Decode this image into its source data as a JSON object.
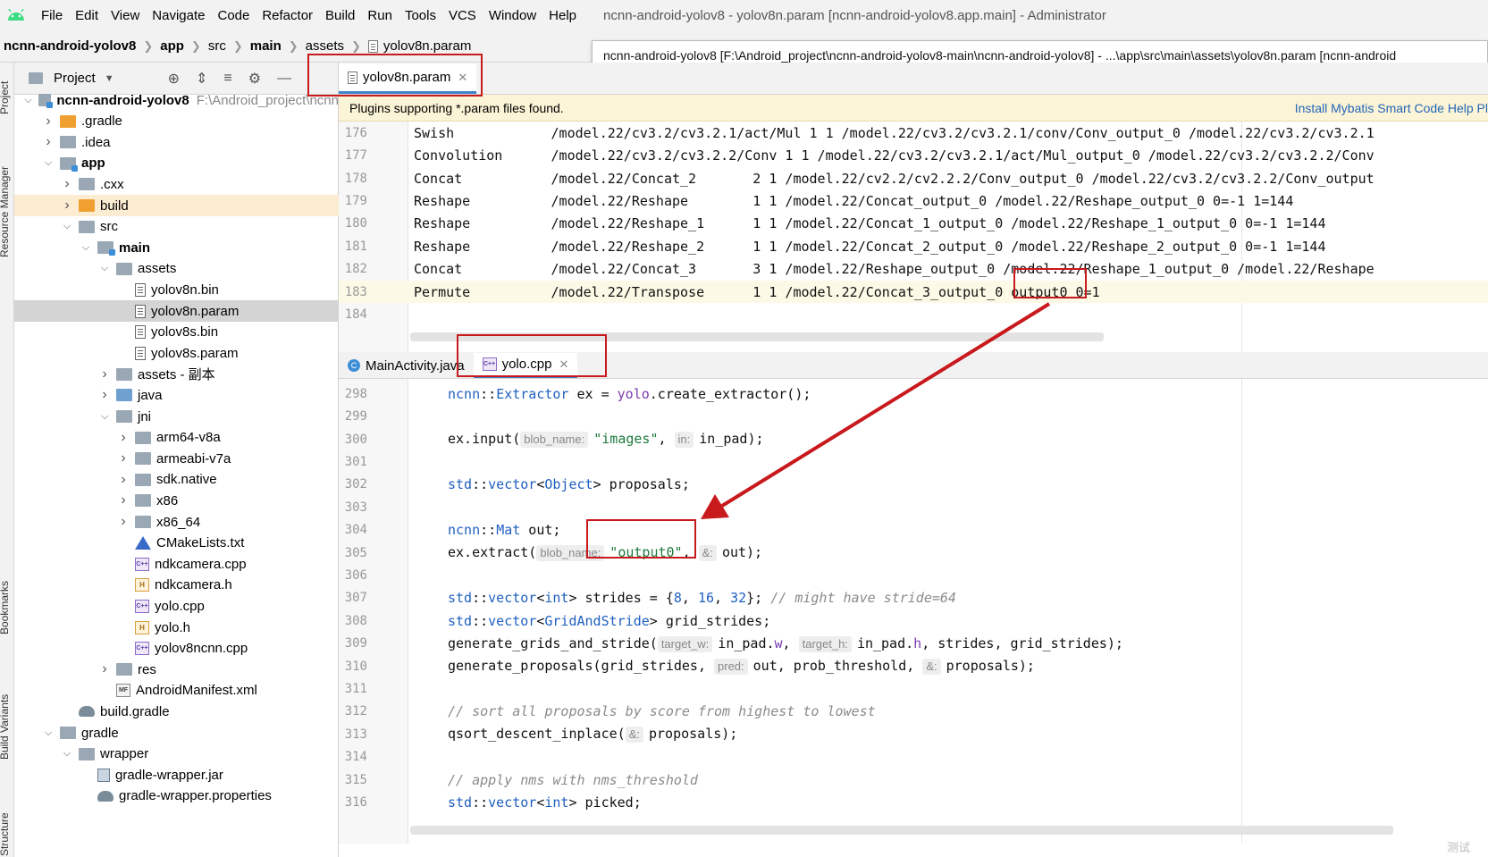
{
  "menubar": {
    "items": [
      "File",
      "Edit",
      "View",
      "Navigate",
      "Code",
      "Refactor",
      "Build",
      "Run",
      "Tools",
      "VCS",
      "Window",
      "Help"
    ],
    "window_title": "ncnn-android-yolov8 - yolov8n.param [ncnn-android-yolov8.app.main] - Administrator"
  },
  "breadcrumb": {
    "items": [
      "ncnn-android-yolov8",
      "app",
      "src",
      "main",
      "assets",
      "yolov8n.param"
    ]
  },
  "tooltip": {
    "text": "ncnn-android-yolov8 [F:\\Android_project\\ncnn-android-yolov8-main\\ncnn-android-yolov8] - ...\\app\\src\\main\\assets\\yolov8n.param [ncnn-android"
  },
  "left_strip": {
    "tabs": [
      "Project",
      "Resource Manager",
      "Bookmarks",
      "Build Variants",
      "Structure"
    ]
  },
  "project_panel": {
    "title": "Project",
    "tree": [
      {
        "label": "ncnn-android-yolov8",
        "extra": "F:\\Android_project\\ncnn",
        "depth": 0,
        "arrow": "open",
        "icon": "module-folder",
        "bold": true
      },
      {
        "label": ".gradle",
        "depth": 1,
        "arrow": "closed",
        "icon": "folder-orange"
      },
      {
        "label": ".idea",
        "depth": 1,
        "arrow": "closed",
        "icon": "folder"
      },
      {
        "label": "app",
        "depth": 1,
        "arrow": "open",
        "icon": "module-folder",
        "bold": true
      },
      {
        "label": ".cxx",
        "depth": 2,
        "arrow": "closed",
        "icon": "folder"
      },
      {
        "label": "build",
        "depth": 2,
        "arrow": "closed",
        "icon": "folder-orange",
        "excluded": true
      },
      {
        "label": "src",
        "depth": 2,
        "arrow": "open",
        "icon": "folder"
      },
      {
        "label": "main",
        "depth": 3,
        "arrow": "open",
        "icon": "module-folder",
        "bold": true
      },
      {
        "label": "assets",
        "depth": 4,
        "arrow": "open",
        "icon": "folder"
      },
      {
        "label": "yolov8n.bin",
        "depth": 5,
        "arrow": "none",
        "icon": "file"
      },
      {
        "label": "yolov8n.param",
        "depth": 5,
        "arrow": "none",
        "icon": "file",
        "selected": true
      },
      {
        "label": "yolov8s.bin",
        "depth": 5,
        "arrow": "none",
        "icon": "file"
      },
      {
        "label": "yolov8s.param",
        "depth": 5,
        "arrow": "none",
        "icon": "file"
      },
      {
        "label": "assets - 副本",
        "depth": 4,
        "arrow": "closed",
        "icon": "folder"
      },
      {
        "label": "java",
        "depth": 4,
        "arrow": "closed",
        "icon": "folder-blue"
      },
      {
        "label": "jni",
        "depth": 4,
        "arrow": "open",
        "icon": "folder"
      },
      {
        "label": "arm64-v8a",
        "depth": 5,
        "arrow": "closed",
        "icon": "folder"
      },
      {
        "label": "armeabi-v7a",
        "depth": 5,
        "arrow": "closed",
        "icon": "folder"
      },
      {
        "label": "sdk.native",
        "depth": 5,
        "arrow": "closed",
        "icon": "folder"
      },
      {
        "label": "x86",
        "depth": 5,
        "arrow": "closed",
        "icon": "folder"
      },
      {
        "label": "x86_64",
        "depth": 5,
        "arrow": "closed",
        "icon": "folder"
      },
      {
        "label": "CMakeLists.txt",
        "depth": 5,
        "arrow": "none",
        "icon": "cmake"
      },
      {
        "label": "ndkcamera.cpp",
        "depth": 5,
        "arrow": "none",
        "icon": "cpp"
      },
      {
        "label": "ndkcamera.h",
        "depth": 5,
        "arrow": "none",
        "icon": "h"
      },
      {
        "label": "yolo.cpp",
        "depth": 5,
        "arrow": "none",
        "icon": "cpp"
      },
      {
        "label": "yolo.h",
        "depth": 5,
        "arrow": "none",
        "icon": "h"
      },
      {
        "label": "yolov8ncnn.cpp",
        "depth": 5,
        "arrow": "none",
        "icon": "cpp"
      },
      {
        "label": "res",
        "depth": 4,
        "arrow": "closed",
        "icon": "folder"
      },
      {
        "label": "AndroidManifest.xml",
        "depth": 4,
        "arrow": "none",
        "icon": "mf"
      },
      {
        "label": "build.gradle",
        "depth": 2,
        "arrow": "none",
        "icon": "gradle"
      },
      {
        "label": "gradle",
        "depth": 1,
        "arrow": "open",
        "icon": "folder"
      },
      {
        "label": "wrapper",
        "depth": 2,
        "arrow": "open",
        "icon": "folder"
      },
      {
        "label": "gradle-wrapper.jar",
        "depth": 3,
        "arrow": "none",
        "icon": "jar"
      },
      {
        "label": "gradle-wrapper.properties",
        "depth": 3,
        "arrow": "none",
        "icon": "gradle"
      }
    ]
  },
  "top_editor": {
    "tab_label": "yolov8n.param",
    "banner_text": "Plugins supporting *.param files found.",
    "banner_link": "Install Mybatis Smart Code Help Pl",
    "lines": [
      {
        "no": "176",
        "text": "Swish            /model.22/cv3.2/cv3.2.1/act/Mul 1 1 /model.22/cv3.2/cv3.2.1/conv/Conv_output_0 /model.22/cv3.2/cv3.2.1"
      },
      {
        "no": "177",
        "text": "Convolution      /model.22/cv3.2/cv3.2.2/Conv 1 1 /model.22/cv3.2/cv3.2.1/act/Mul_output_0 /model.22/cv3.2/cv3.2.2/Conv"
      },
      {
        "no": "178",
        "text": "Concat           /model.22/Concat_2       2 1 /model.22/cv2.2/cv2.2.2/Conv_output_0 /model.22/cv3.2/cv3.2.2/Conv_output"
      },
      {
        "no": "179",
        "text": "Reshape          /model.22/Reshape        1 1 /model.22/Concat_output_0 /model.22/Reshape_output_0 0=-1 1=144"
      },
      {
        "no": "180",
        "text": "Reshape          /model.22/Reshape_1      1 1 /model.22/Concat_1_output_0 /model.22/Reshape_1_output_0 0=-1 1=144"
      },
      {
        "no": "181",
        "text": "Reshape          /model.22/Reshape_2      1 1 /model.22/Concat_2_output_0 /model.22/Reshape_2_output_0 0=-1 1=144"
      },
      {
        "no": "182",
        "text": "Concat           /model.22/Concat_3       3 1 /model.22/Reshape_output_0 /model.22/Reshape_1_output_0 /model.22/Reshape"
      },
      {
        "no": "183",
        "text": "Permute          /model.22/Transpose      1 1 /model.22/Concat_3_output_0 output0 0=1"
      },
      {
        "no": "184",
        "text": ""
      }
    ]
  },
  "bottom_editor": {
    "tabs": [
      {
        "label": "MainActivity.java",
        "active": false
      },
      {
        "label": "yolo.cpp",
        "active": true
      }
    ],
    "line_numbers": [
      "298",
      "299",
      "300",
      "301",
      "302",
      "303",
      "304",
      "305",
      "306",
      "307",
      "308",
      "309",
      "310",
      "311",
      "312",
      "313",
      "314",
      "315",
      "316"
    ],
    "code": {
      "l298_a": "ncnn",
      "l298_b": "::",
      "l298_c": "Extractor",
      "l298_d": " ex = ",
      "l298_e": "yolo",
      "l298_f": ".create_extractor();",
      "l300_a": "ex.input(",
      "l300_hint1": "blob_name:",
      "l300_str": "\"images\"",
      "l300_b": ", ",
      "l300_hint2": "in:",
      "l300_c": "in_pad);",
      "l302_a": "std",
      "l302_b": "::",
      "l302_c": "vector",
      "l302_d": "<",
      "l302_e": "Object",
      "l302_f": "> proposals;",
      "l304_a": "ncnn",
      "l304_b": "::",
      "l304_c": "Mat",
      "l304_d": " out;",
      "l305_a": "ex.extract(",
      "l305_hint1": "blob_name:",
      "l305_str": "\"output0\"",
      "l305_b": ", ",
      "l305_hint2": "&:",
      "l305_c": "out);",
      "l307_a": "std",
      "l307_b": "::",
      "l307_c": "vector",
      "l307_d": "<",
      "l307_e": "int",
      "l307_f": "> strides = {",
      "l307_n1": "8",
      "l307_g": ", ",
      "l307_n2": "16",
      "l307_h": ", ",
      "l307_n3": "32",
      "l307_i": "}; ",
      "l307_cmt": "// might have stride=64",
      "l308_a": "std",
      "l308_b": "::",
      "l308_c": "vector",
      "l308_d": "<",
      "l308_e": "GridAndStride",
      "l308_f": "> grid_strides;",
      "l309_a": "generate_grids_and_stride(",
      "l309_hint1": "target_w:",
      "l309_b": "in_pad.",
      "l309_w": "w",
      "l309_c": ", ",
      "l309_hint2": "target_h:",
      "l309_d": "in_pad.",
      "l309_h": "h",
      "l309_e": ", strides, grid_strides);",
      "l310_a": "generate_proposals(grid_strides, ",
      "l310_hint1": "pred:",
      "l310_b": "out, prob_threshold, ",
      "l310_hint2": "&:",
      "l310_c": "proposals);",
      "l312_cmt": "// sort all proposals by score from highest to lowest",
      "l313_a": "qsort_descent_inplace(",
      "l313_hint": "&:",
      "l313_b": "proposals);",
      "l315_cmt": "// apply nms with nms_threshold",
      "l316_a": "std",
      "l316_b": "::",
      "l316_c": "vector",
      "l316_d": "<",
      "l316_e": "int",
      "l316_f": "> picked;"
    }
  },
  "colors": {
    "annotation_red": "#c8191c",
    "accent_blue": "#4083c9",
    "banner_bg": "#fbf4d6"
  },
  "watermark": "测试"
}
